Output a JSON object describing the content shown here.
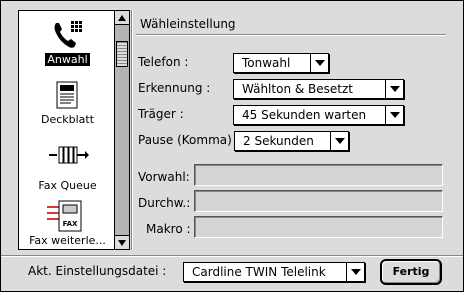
{
  "sidebar": {
    "items": [
      {
        "label": "Anwahl",
        "icon": "telephone-icon",
        "selected": true
      },
      {
        "label": "Deckblatt",
        "icon": "document-icon",
        "selected": false
      },
      {
        "label": "Fax Queue",
        "icon": "fax-queue-icon",
        "selected": false
      },
      {
        "label": "Fax weiterle...",
        "icon": "fax-forward-icon",
        "selected": false
      }
    ]
  },
  "panel": {
    "title": "Wähleinstellung",
    "telefon": {
      "label": "Telefon :",
      "value": "Tonwahl"
    },
    "erkennung": {
      "label": "Erkennung :",
      "value": "Wählton & Besetzt"
    },
    "traeger": {
      "label": "Träger :",
      "value": "45  Sekunden warten"
    },
    "pause": {
      "label": "Pause (Komma)",
      "value": "2  Sekunden"
    },
    "vorwahl": {
      "label": "Vorwahl:",
      "value": ""
    },
    "durchw": {
      "label": "Durchw.:",
      "value": ""
    },
    "makro": {
      "label": "Makro :",
      "value": ""
    }
  },
  "footer": {
    "settings_file_label": "Akt. Einstellungsdatei :",
    "settings_file_value": "Cardline TWIN Telelink",
    "done_button": "Fertig"
  }
}
